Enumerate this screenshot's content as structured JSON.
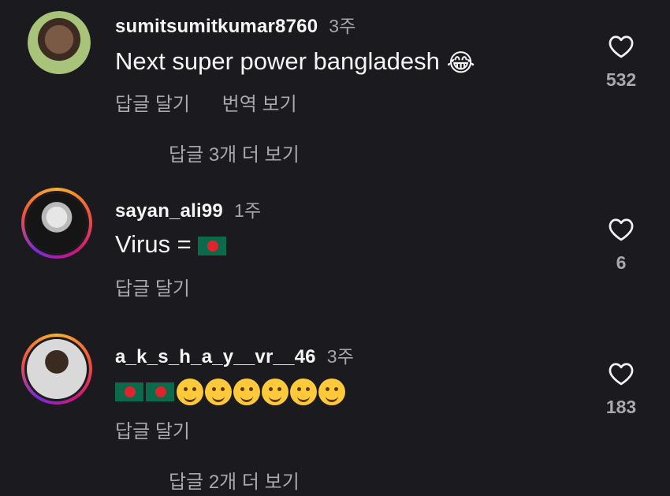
{
  "comments": [
    {
      "username": "sumitsumitkumar8760",
      "time": "3주",
      "text": "Next super power bangladesh",
      "text_emoji": "😂",
      "reply_label": "답글 달기",
      "translate_label": "번역 보기",
      "like_count": "532",
      "more_replies": "답글 3개 더 보기"
    },
    {
      "username": "sayan_ali99",
      "time": "1주",
      "text": "Virus =",
      "reply_label": "답글 달기",
      "like_count": "6"
    },
    {
      "username": "a_k_s_h_a_y__vr__46",
      "time": "3주",
      "reply_label": "답글 달기",
      "like_count": "183",
      "more_replies": "답글 2개 더 보기"
    }
  ],
  "icons": {
    "like": "heart-outline-icon",
    "flag": "bangladesh-flag-icon"
  },
  "colors": {
    "background": "#1b1b1f",
    "muted": "#a9a9ad",
    "story_ring": "#d1167a"
  }
}
